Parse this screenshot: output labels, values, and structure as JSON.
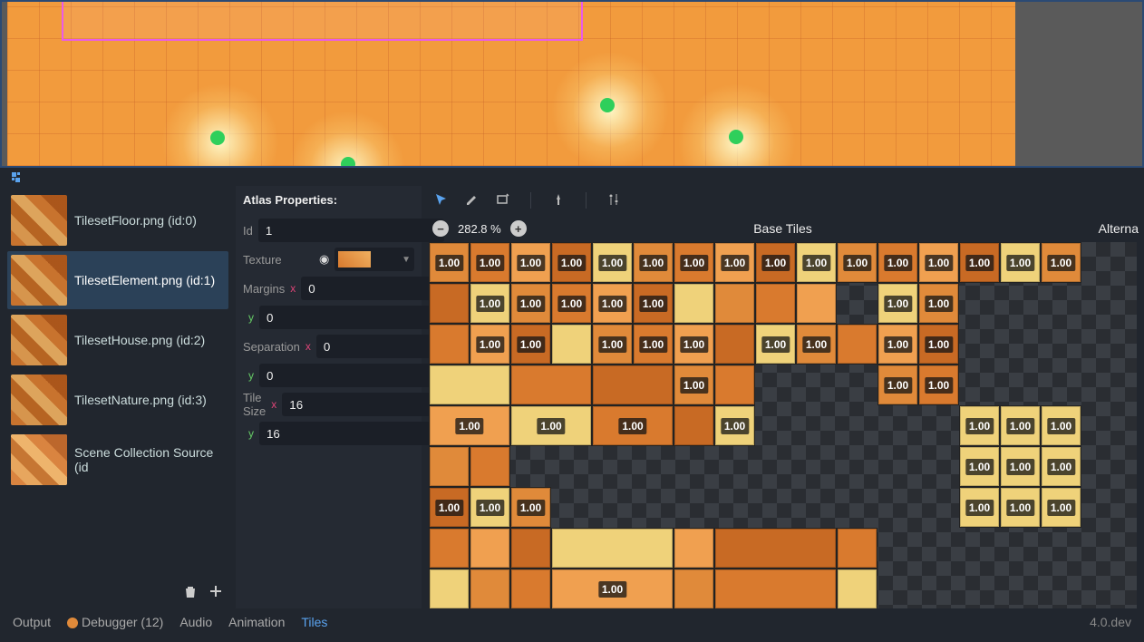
{
  "viewport": {
    "dots": 4
  },
  "sources": {
    "items": [
      {
        "label": "TilesetFloor.png (id:0)"
      },
      {
        "label": "TilesetElement.png (id:1)"
      },
      {
        "label": "TilesetHouse.png (id:2)"
      },
      {
        "label": "TilesetNature.png (id:3)"
      },
      {
        "label": "Scene Collection Source (id"
      }
    ],
    "selected_index": 1
  },
  "atlas_props": {
    "title": "Atlas Properties:",
    "id_label": "Id",
    "id_value": "1",
    "texture_label": "Texture",
    "margins_label": "Margins",
    "margins_x": "0",
    "margins_y": "0",
    "separation_label": "Separation",
    "separation_x": "0",
    "separation_y": "0",
    "tile_size_label": "Tile Size",
    "tile_w": "16",
    "tile_h": "16"
  },
  "zoom": {
    "value": "282.8 %"
  },
  "headers": {
    "base": "Base Tiles",
    "alt": "Alterna"
  },
  "badge_value": "1.00",
  "bottom": {
    "output": "Output",
    "debugger": "Debugger (12)",
    "audio": "Audio",
    "animation": "Animation",
    "tiles": "Tiles",
    "version": "4.0.dev"
  }
}
